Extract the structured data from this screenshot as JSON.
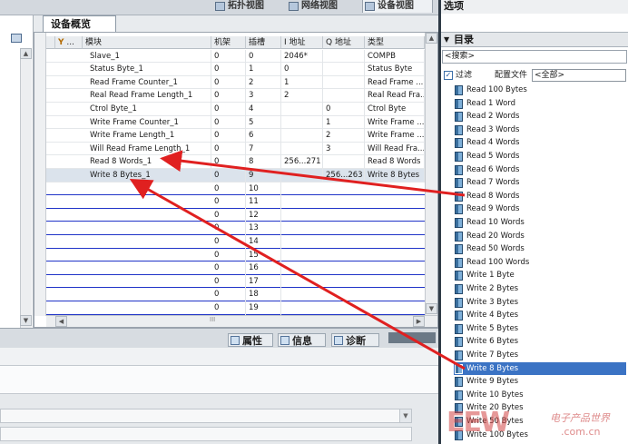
{
  "view_tabs": {
    "topology": "拓扑视图",
    "network": "网络视图",
    "device": "设备视图"
  },
  "overview_tab": "设备概览",
  "table": {
    "headers": {
      "filter": "...",
      "module": "模块",
      "rack": "机架",
      "slot": "插槽",
      "i_address": "I 地址",
      "q_address": "Q 地址",
      "type": "类型"
    },
    "rows": [
      {
        "module": "Slave_1",
        "rack": "0",
        "slot": "0",
        "i_address": "2046*",
        "q_address": "",
        "type": "COMPB"
      },
      {
        "module": "Status Byte_1",
        "rack": "0",
        "slot": "1",
        "i_address": "0",
        "q_address": "",
        "type": "Status Byte"
      },
      {
        "module": "Read Frame Counter_1",
        "rack": "0",
        "slot": "2",
        "i_address": "1",
        "q_address": "",
        "type": "Read Frame ..."
      },
      {
        "module": "Real Read Frame Length_1",
        "rack": "0",
        "slot": "3",
        "i_address": "2",
        "q_address": "",
        "type": "Real Read Fra..."
      },
      {
        "module": "Ctrol Byte_1",
        "rack": "0",
        "slot": "4",
        "i_address": "",
        "q_address": "0",
        "type": "Ctrol Byte"
      },
      {
        "module": "Write Frame Counter_1",
        "rack": "0",
        "slot": "5",
        "i_address": "",
        "q_address": "1",
        "type": "Write Frame ..."
      },
      {
        "module": "Write Frame Length_1",
        "rack": "0",
        "slot": "6",
        "i_address": "",
        "q_address": "2",
        "type": "Write Frame ..."
      },
      {
        "module": "Will Read Frame Length_1",
        "rack": "0",
        "slot": "7",
        "i_address": "",
        "q_address": "3",
        "type": "Will Read Fra..."
      },
      {
        "module": "Read 8 Words_1",
        "rack": "0",
        "slot": "8",
        "i_address": "256...271",
        "q_address": "",
        "type": "Read 8 Words"
      },
      {
        "module": "Write 8 Bytes_1",
        "rack": "0",
        "slot": "9",
        "i_address": "",
        "q_address": "256...263",
        "type": "Write 8 Bytes"
      }
    ],
    "empty_rows": [
      {
        "rack": "0",
        "slot": "10"
      },
      {
        "rack": "0",
        "slot": "11"
      },
      {
        "rack": "0",
        "slot": "12"
      },
      {
        "rack": "0",
        "slot": "13"
      },
      {
        "rack": "0",
        "slot": "14"
      },
      {
        "rack": "0",
        "slot": "15"
      },
      {
        "rack": "0",
        "slot": "16"
      },
      {
        "rack": "0",
        "slot": "17"
      },
      {
        "rack": "0",
        "slot": "18"
      },
      {
        "rack": "0",
        "slot": "19"
      }
    ],
    "hscroll_thumb": "III"
  },
  "bottom_tabs": {
    "properties": "属性",
    "info": "信息",
    "diagnostics": "诊断"
  },
  "right_panel": {
    "title": "选项",
    "catalog_title": "目录",
    "search_placeholder": "<搜索>",
    "filter_label": "过滤",
    "profile_label": "配置文件",
    "profile_value": "<全部>",
    "items": [
      "Read 100 Bytes",
      "Read 1 Word",
      "Read 2 Words",
      "Read 3 Words",
      "Read 4 Words",
      "Read 5 Words",
      "Read 6 Words",
      "Read 7 Words",
      "Read 8 Words",
      "Read 9 Words",
      "Read 10 Words",
      "Read 20 Words",
      "Read 50 Words",
      "Read 100 Words",
      "Write 1 Byte",
      "Write 2 Bytes",
      "Write 3 Bytes",
      "Write 4 Bytes",
      "Write 5 Bytes",
      "Write 6 Bytes",
      "Write 7 Bytes",
      "Write 8 Bytes",
      "Write 9 Bytes",
      "Write 10 Bytes",
      "Write 20 Bytes",
      "Write 50 Bytes",
      "Write 100 Bytes"
    ],
    "selected_item": "Write 8 Bytes"
  },
  "watermark": {
    "logo": "EEW",
    "cn": "电子产品世界",
    "url": ".com.cn"
  },
  "colors": {
    "annotation_arrow": "#e02020",
    "selection": "#3b73c4",
    "empty_row_line": "#1f33c8"
  }
}
